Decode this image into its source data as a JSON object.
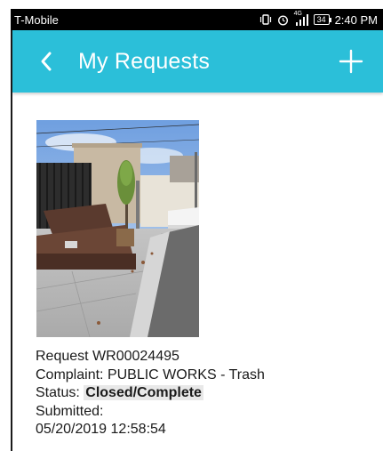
{
  "status_bar": {
    "carrier": "T-Mobile",
    "network": "4G",
    "battery": "34",
    "time": "2:40 PM"
  },
  "app_bar": {
    "title": "My Requests",
    "background_color": "#2bbfd9",
    "back_icon": "chevron-left-icon",
    "add_icon": "plus-icon"
  },
  "request": {
    "request_label": "Request",
    "request_id": "WR00024495",
    "complaint_label": "Complaint:",
    "complaint_value": "PUBLIC WORKS - Trash",
    "status_label": "Status:",
    "status_value": "Closed/Complete",
    "submitted_label": "Submitted:",
    "submitted_value": "05/20/2019 12:58:54"
  }
}
